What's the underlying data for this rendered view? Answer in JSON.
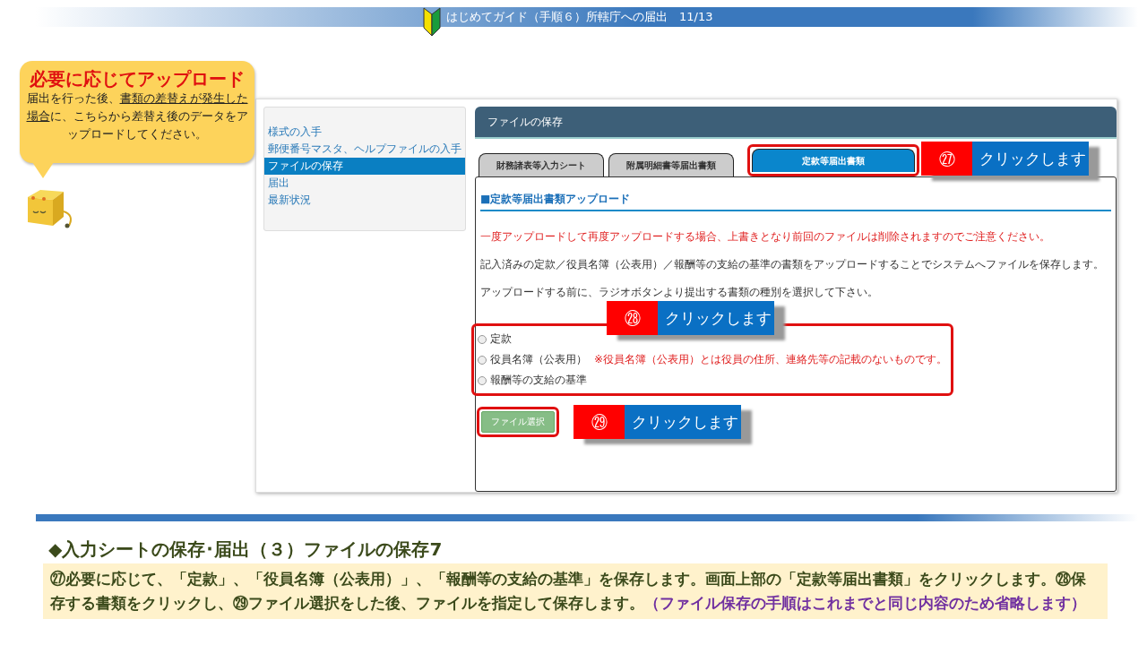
{
  "header": {
    "title": "はじめてガイド（手順６）所轄庁への届出　11/13"
  },
  "callout": {
    "title": "必要に応じてアップロード",
    "segments": [
      {
        "text": "届出を行った後、",
        "underline": false
      },
      {
        "text": "書類の差替えが",
        "underline": true
      },
      {
        "text": "発生した場合",
        "underline": true
      },
      {
        "text": "に、こちらから差替え後のデータをアップロードしてください。",
        "underline": false
      }
    ]
  },
  "sidebar": {
    "items": [
      {
        "label": "様式の入手",
        "selected": false
      },
      {
        "label": "郵便番号マスタ、ヘルプファイルの入手",
        "selected": false
      },
      {
        "label": "ファイルの保存",
        "selected": true
      },
      {
        "label": "届出",
        "selected": false
      },
      {
        "label": "最新状況",
        "selected": false
      }
    ]
  },
  "panel": {
    "title": "ファイルの保存",
    "tabs": [
      {
        "label": "財務諸表等入力シート",
        "selected": false,
        "highlighted": false
      },
      {
        "label": "附属明細書等届出書類",
        "selected": false,
        "highlighted": false
      },
      {
        "label": "定款等届出書類",
        "selected": true,
        "highlighted": true
      }
    ],
    "section_title": "■定款等届出書類アップロード",
    "warning": "一度アップロードして再度アップロードする場合、上書きとなり前回のファイルは削除されますのでご注意ください。",
    "paragraphs": [
      "記入済みの定款／役員名簿（公表用）／報酬等の支給の基準の書類をアップロードすることでシステムへファイルを保存します。",
      "アップロードする前に、ラジオボタンより提出する書類の種別を選択して下さい。"
    ],
    "radios_highlighted": true,
    "radios": [
      {
        "label": "定款",
        "selected": false
      },
      {
        "label": "役員名簿（公表用）",
        "selected": false,
        "note": "※役員名簿（公表用）とは役員の住所、連絡先等の記載のないものです。"
      },
      {
        "label": "報酬等の支給の基準",
        "selected": false
      }
    ],
    "file_button": {
      "label": "ファイル選択",
      "highlighted": true
    }
  },
  "annotations": [
    {
      "number": "㉗",
      "text": "クリックします"
    },
    {
      "number": "㉘",
      "text": "クリックします"
    },
    {
      "number": "㉙",
      "text": "クリックします"
    }
  ],
  "footer": {
    "heading": "◆入力シートの保存･届出（３）ファイルの保存7",
    "segments": [
      {
        "text": "㉗必要に応じて、「定款」、「役員名簿（公表用）」、「報酬等の支給の基準」を保存します。画面上部の「定款等届出書類」をクリックします。㉘保存する書類をクリックし、㉙ファイル選択をした後、ファイルを指定して保存します。",
        "emphasis": false
      },
      {
        "text": "（ファイル保存の手順はこれまでと同じ内容のため省略します）",
        "emphasis": true
      }
    ]
  }
}
